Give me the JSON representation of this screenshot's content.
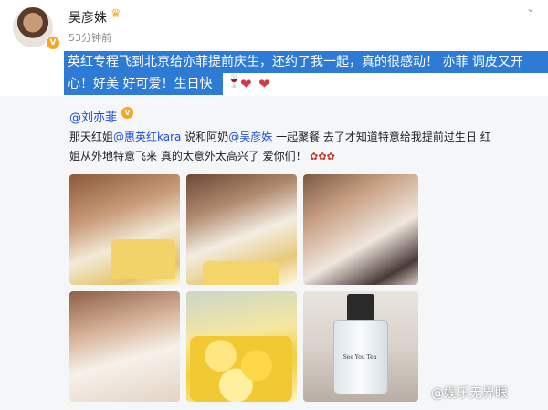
{
  "post": {
    "author": "吴彦姝",
    "crown_icon": "crown-icon",
    "verified_badge": "V",
    "time": "53分钟前",
    "text_line1": "英红专程飞到北京给亦菲提前庆生，还约了我一起，真的很感动！ 亦菲 调皮又开",
    "text_line2": "心！好美 好可爱！生日快乐"
  },
  "repost": {
    "author": "@刘亦菲",
    "verified_badge": "V",
    "line1_a": "那天红姐",
    "mention1": "@惠英红kara",
    "line1_b": " 说和阿奶",
    "mention2": "@吴彦姝",
    "line1_c": " 一起聚餐 去了才知道特意给我提前过生日 红",
    "line2": "姐从外地特意飞来 真的太意外太高兴了 爱你们！",
    "bottle_label": "See You Tea"
  },
  "watermark": "@娱乐无界眼",
  "colors": {
    "highlight": "#2e7bd6",
    "link": "#1d4ed8",
    "repost_bg": "#f4f6f8"
  }
}
